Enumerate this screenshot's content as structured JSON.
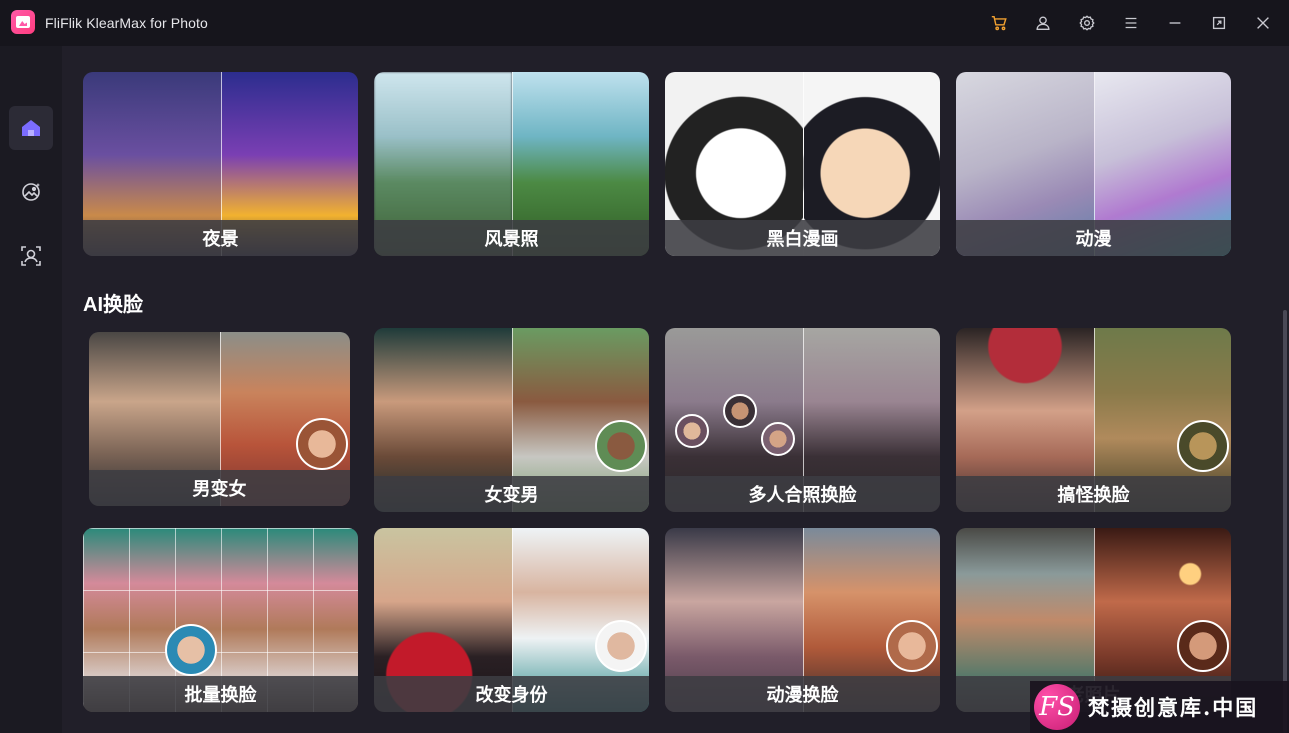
{
  "app": {
    "title": "FliFlik KlearMax for Photo"
  },
  "titlebar": {
    "icons": [
      "cart-icon",
      "user-icon",
      "settings-icon",
      "menu-icon",
      "minimize-icon",
      "maximize-icon",
      "close-icon"
    ],
    "cart_color": "#f0a030"
  },
  "sidebar": {
    "items": [
      {
        "icon": "home-icon",
        "active": true
      },
      {
        "icon": "photo-enhance-icon",
        "active": false
      },
      {
        "icon": "face-scan-icon",
        "active": false
      }
    ],
    "accent": "#7b6cff"
  },
  "enhance_cards": [
    {
      "label": "夜景"
    },
    {
      "label": "风景照"
    },
    {
      "label": "黑白漫画"
    },
    {
      "label": "动漫"
    }
  ],
  "face_swap": {
    "section_title": "AI换脸",
    "cards": [
      {
        "label": "男变女"
      },
      {
        "label": "女变男"
      },
      {
        "label": "多人合照换脸"
      },
      {
        "label": "搞怪换脸"
      },
      {
        "label": "批量换脸"
      },
      {
        "label": "改变身份"
      },
      {
        "label": "动漫换脸"
      },
      {
        "label": "老照片"
      }
    ]
  },
  "watermark": {
    "logo": "FS",
    "text": "梵摄创意库.中国"
  }
}
